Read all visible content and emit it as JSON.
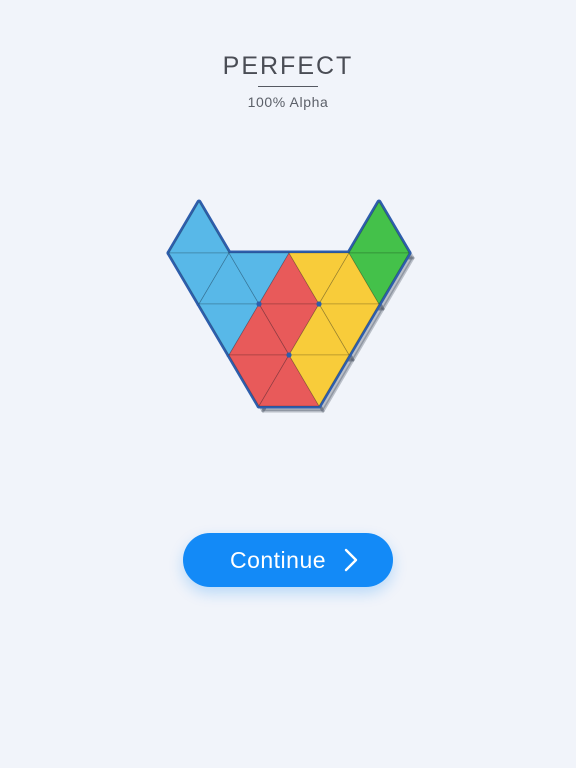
{
  "header": {
    "title": "PERFECT",
    "subtitle": "100% Alpha"
  },
  "puzzle": {
    "colors": {
      "blue": "#58b8e8",
      "red": "#e85a5a",
      "yellow": "#f8cc3a",
      "green": "#44c14a",
      "outline": "#2e5eac"
    },
    "pieces": [
      {
        "name": "blue-piece",
        "color": "blue"
      },
      {
        "name": "red-piece",
        "color": "red"
      },
      {
        "name": "yellow-piece",
        "color": "yellow"
      },
      {
        "name": "green-piece",
        "color": "green"
      }
    ]
  },
  "continue_button": {
    "label": "Continue",
    "icon": "chevron-right-icon",
    "color": "#138af7"
  }
}
